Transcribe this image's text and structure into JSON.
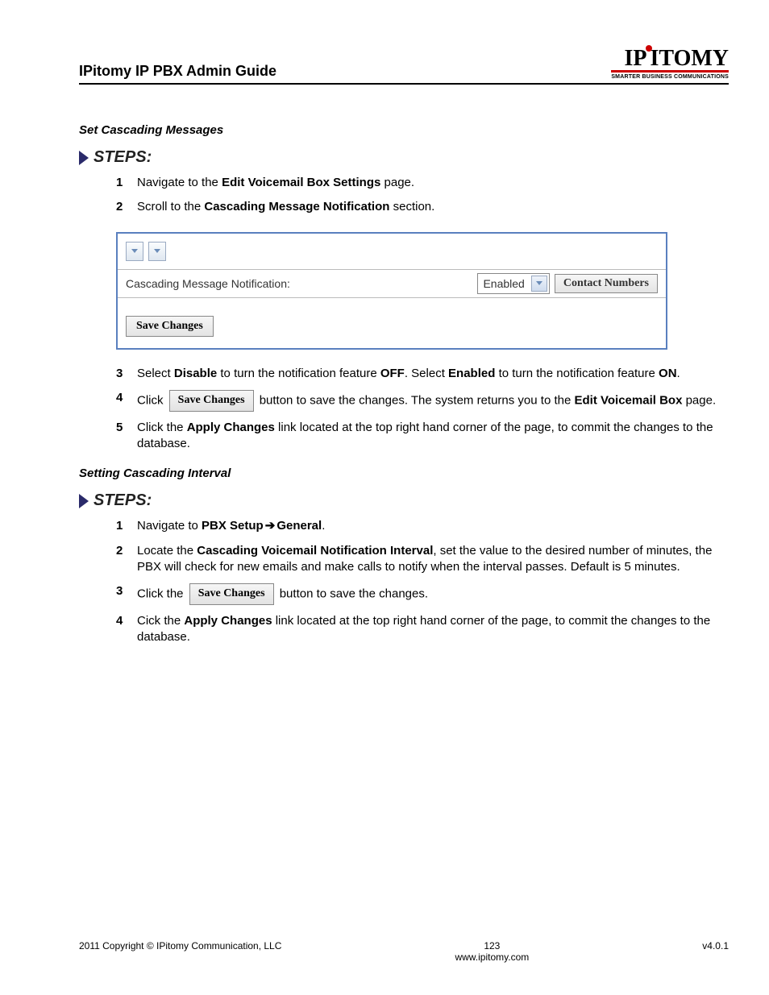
{
  "header": {
    "title": "IPitomy IP PBX Admin Guide",
    "logo_brand": "IPITOMY",
    "logo_tag": "SMARTER BUSINESS COMMUNICATIONS"
  },
  "section1": {
    "title": "Set Cascading Messages",
    "steps_label": "STEPS:",
    "steps": {
      "s1_pre": "Navigate to the ",
      "s1_b": "Edit Voicemail Box Settings",
      "s1_post": " page.",
      "s2_pre": "Scroll to the ",
      "s2_b": "Cascading Message Notification",
      "s2_post": " section.",
      "s3_a": "Select ",
      "s3_b1": "Disable",
      "s3_c": " to turn the notification feature ",
      "s3_b2": "OFF",
      "s3_d": ". Select ",
      "s3_b3": "Enabled",
      "s3_e": " to turn the notification feature ",
      "s3_b4": "ON",
      "s3_f": ".",
      "s4_a": "Click ",
      "s4_btn": "Save Changes",
      "s4_b": " button to save the changes. The system returns you to the ",
      "s4_b1": "Edit Voicemail Box",
      "s4_c": " page.",
      "s5_a": "Click the ",
      "s5_b1": "Apply Changes",
      "s5_b": " link located at the top right hand corner of the page, to commit the changes to the database."
    }
  },
  "panel": {
    "label": "Cascading Message Notification:",
    "dropdown_value": "Enabled",
    "contact_btn": "Contact Numbers",
    "save_btn": "Save Changes"
  },
  "section2": {
    "title": "Setting Cascading Interval",
    "steps_label": "STEPS:",
    "steps": {
      "s1_a": "Navigate to ",
      "s1_b1": "PBX Setup",
      "s1_arrow": "➔",
      "s1_b2": "General",
      "s1_c": ".",
      "s2_a": "Locate the ",
      "s2_b1": "Cascading Voicemail Notification Interval",
      "s2_b": ", set the value to the desired number of minutes, the PBX will check for new emails and make calls to notify when the interval passes.  Default is 5 minutes.",
      "s3_a": "Click the ",
      "s3_btn": "Save Changes",
      "s3_b": " button to save the changes.",
      "s4_a": "Cick the ",
      "s4_b1": "Apply Changes",
      "s4_b": " link located at the top right hand corner of the page, to commit the changes to the database."
    }
  },
  "footer": {
    "left": "2011 Copyright © IPitomy Communication, LLC",
    "page": "123",
    "url": "www.ipitomy.com",
    "right": "v4.0.1"
  }
}
